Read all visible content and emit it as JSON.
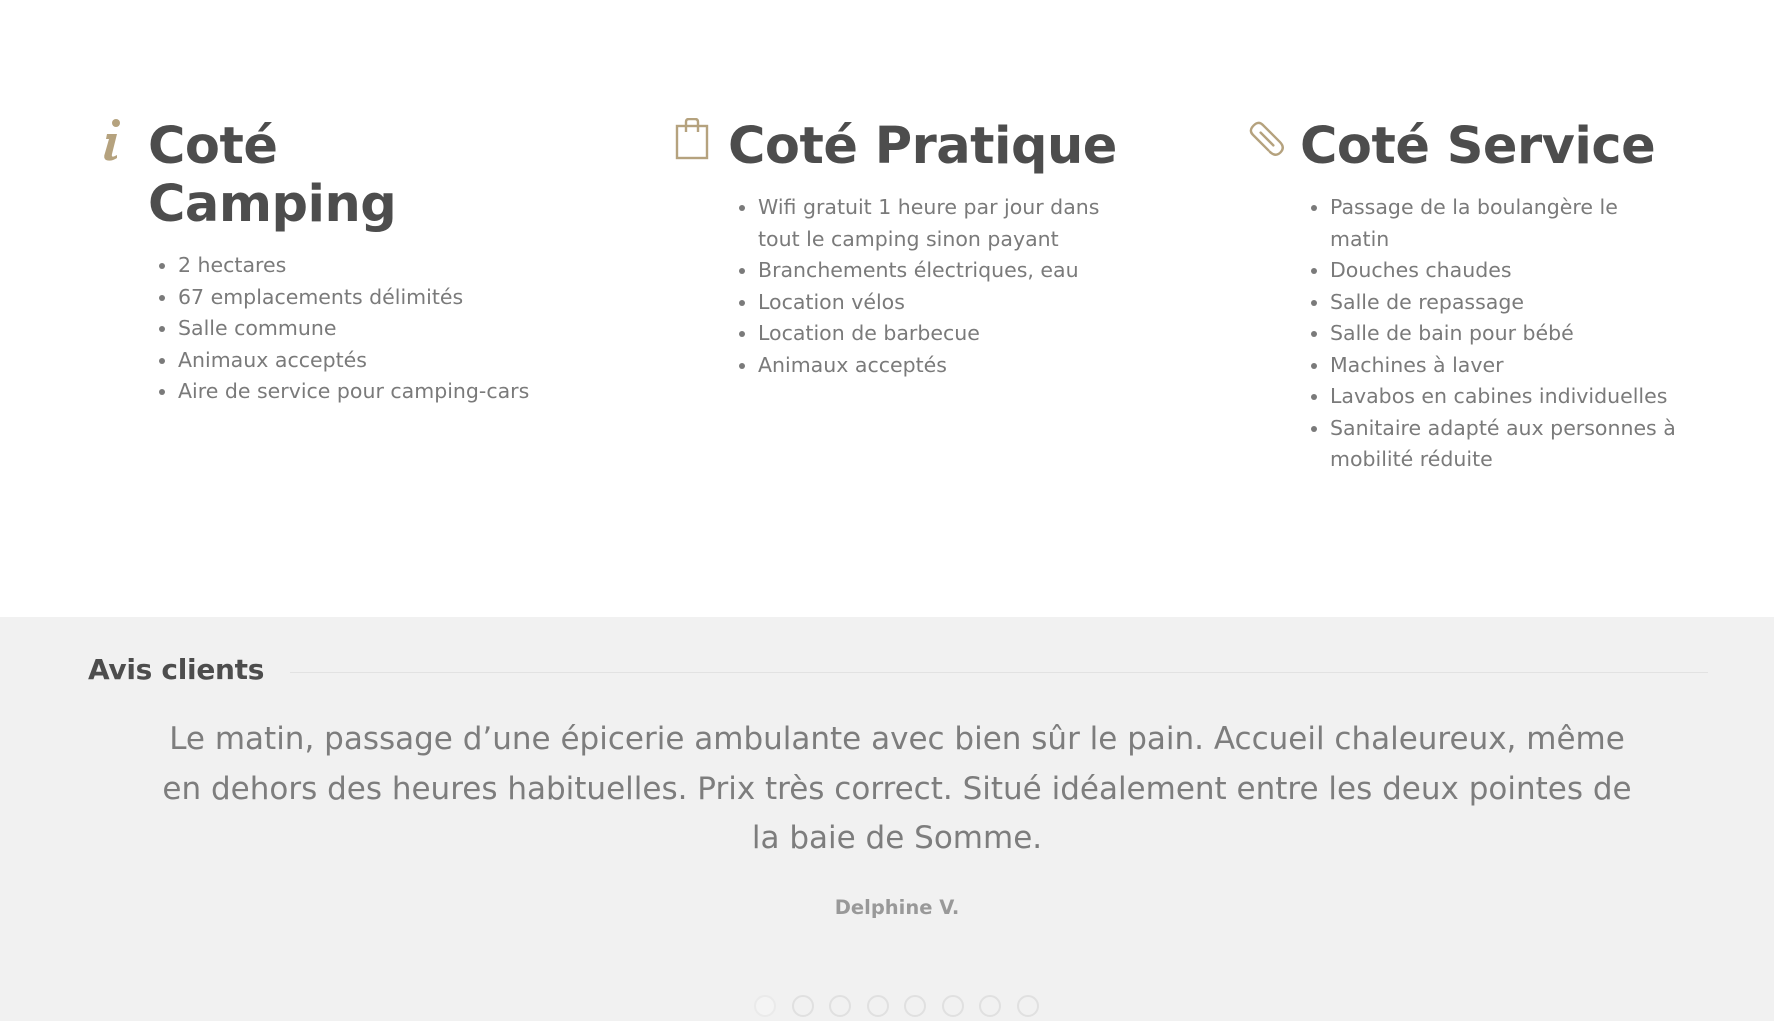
{
  "accent_color": "#b5a27e",
  "features": [
    {
      "icon": "info-icon",
      "title": "Coté Camping",
      "items": [
        "2 hectares",
        "67 emplacements délimités",
        "Salle commune",
        "Animaux acceptés",
        "Aire de service pour camping-cars"
      ]
    },
    {
      "icon": "shopping-bag-icon",
      "title": "Coté Pratique",
      "items": [
        "Wifi gratuit 1 heure par jour dans tout le camping sinon payant",
        "Branchements électriques, eau",
        "Location vélos",
        "Location de barbecue",
        "Animaux acceptés"
      ]
    },
    {
      "icon": "paperclip-icon",
      "title": "Coté Service",
      "items": [
        "Passage de la boulangère le matin",
        "Douches chaudes",
        "Salle de repassage",
        "Salle de bain pour bébé",
        "Machines à laver",
        "Lavabos en cabines individuelles",
        "Sanitaire adapté aux personnes à mobilité réduite"
      ]
    }
  ],
  "reviews": {
    "heading": "Avis clients",
    "quote": "Le matin, passage d’une épicerie ambulante avec bien sûr le pain. Accueil chaleureux, même en dehors des heures habituelles. Prix très correct. Situé idéalement entre les deux pointes de la baie de Somme.",
    "author": "Delphine V.",
    "slide_count": 8,
    "active_slide": 1
  }
}
